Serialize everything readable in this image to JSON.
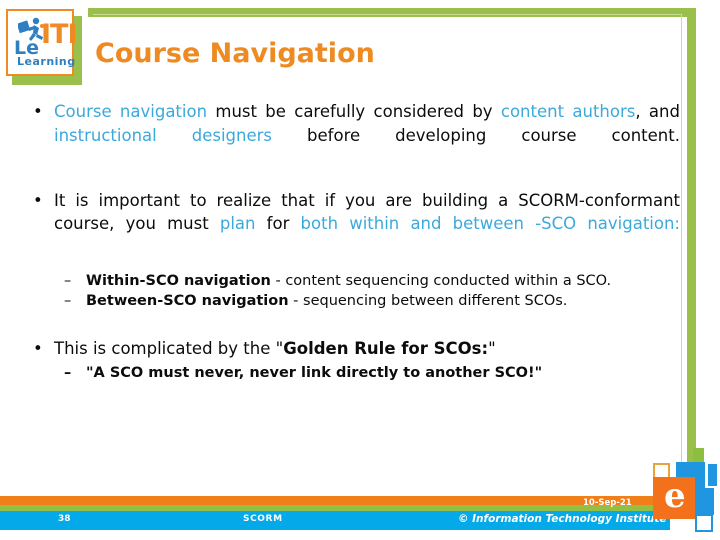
{
  "slide": {
    "page_number": "38",
    "footer_center": "SCORM",
    "footer_date": "10-Sep-21",
    "footer_copyright": "© Information Technology Institute",
    "title": "Course Navigation",
    "colors": {
      "title_orange": "#ED8B22",
      "highlight_blue": "#3BA9DC",
      "frame_green": "#9ABF4B",
      "bar_orange": "#F07F1A",
      "bar_green": "#94BF45",
      "bar_blue": "#03A9E8"
    }
  },
  "logo": {
    "iti": "ITI",
    "le": "Le",
    "learning": "Learning"
  },
  "brand_logo": {
    "letter": "e"
  },
  "content": {
    "bullet1": {
      "marker": "•",
      "part1": "Course navigation",
      "part2": " must be carefully considered by ",
      "part3": "content authors",
      "part4": ", and ",
      "part5": "instructional designers",
      "part6": " before developing course content."
    },
    "bullet2": {
      "marker": "•",
      "part1": "It is important to realize that if you are building a SCORM-conformant course, you must ",
      "part2": "plan",
      "part3": " for ",
      "part4": "both within and between -SCO navigation:"
    },
    "sub1": {
      "marker": "–",
      "term": "Within-SCO navigation",
      "text": " - content sequencing conducted within a SCO."
    },
    "sub2": {
      "marker": "–",
      "term": "Between-SCO navigation",
      "text": " - sequencing between different SCOs."
    },
    "bullet3": {
      "marker": "•",
      "part1": "This is complicated by the \"",
      "part2": "Golden Rule for SCOs:",
      "part3": "\""
    },
    "sub3": {
      "marker": "–",
      "text": "\"A SCO must never, never link directly to another SCO!\""
    }
  }
}
